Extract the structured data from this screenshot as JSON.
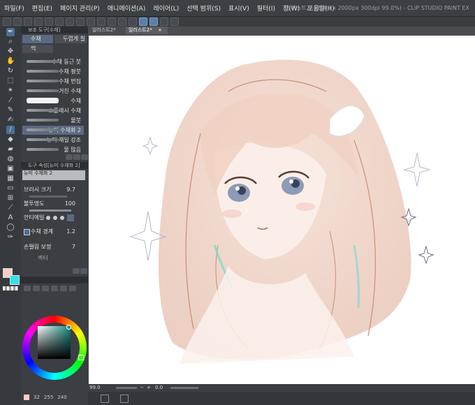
{
  "window_title": "일러스트2* (1600 x 2000px 300dpi 99.0%)  - CLIP STUDIO PAINT EX",
  "menu": [
    "파일(F)",
    "편집(E)",
    "페이지 관리(P)",
    "애니메이션(A)",
    "레이어(L)",
    "선택 범위(S)",
    "표시(V)",
    "필터(I)",
    "창(W)",
    "도움말(H)"
  ],
  "canvas_tabs": [
    {
      "label": "일러스트2*"
    },
    {
      "label": "일러스트2*"
    }
  ],
  "subtool": {
    "panel_title": "보조 도구[수채]",
    "group_tabs": [
      "수채",
      "두껍게 칠",
      "먹"
    ],
    "brushes": [
      {
        "label": "수채 둥근 붓",
        "selected": false
      },
      {
        "label": "수채 평붓",
        "selected": false
      },
      {
        "label": "수채 번짐",
        "selected": false
      },
      {
        "label": "거친 수채",
        "selected": false
      },
      {
        "label": "수채",
        "selected": false
      },
      {
        "label": "스플래시 수채",
        "selected": false
      },
      {
        "label": "물붓",
        "selected": false
      },
      {
        "label": "뉴미 수채화 2",
        "selected": true
      },
      {
        "label": "뉴미 채일 강조",
        "selected": false
      },
      {
        "label": "물 많음",
        "selected": false
      }
    ]
  },
  "tool_property": {
    "panel_title": "도구 속성[뉴미 수채화 2]",
    "preview_label": "뉴미 수채화 2",
    "brush_size_label": "브러시 크기",
    "brush_size_value": "9.7",
    "opacity_label": "불투명도",
    "opacity_value": "100",
    "stabilize_label": "안티에일",
    "edge_label": "수채 경계",
    "edge_value": "1.2",
    "correction_label": "손떨림 보정",
    "correction_value": "7",
    "extra_label": "벡터"
  },
  "status": {
    "zoom": "99.0",
    "angle": "0.0"
  },
  "color_values": [
    "32",
    "255",
    "240"
  ],
  "colors": {
    "main_color": "#f7cdc6",
    "sub_color": "#35e0e6",
    "accent": "#4b6e96"
  },
  "tools": [
    "pen-icon",
    "zoom-icon",
    "move-icon",
    "hand-icon",
    "rotate-icon",
    "select-icon",
    "lasso-icon",
    "eyedropper-icon",
    "pencil-icon",
    "brush-icon",
    "airbrush-icon",
    "decoration-icon",
    "eraser-icon",
    "blend-icon",
    "fill-icon",
    "gradient-icon",
    "figure-icon",
    "frame-icon",
    "ruler-icon",
    "text-icon",
    "balloon-icon",
    "correct-line-icon"
  ]
}
